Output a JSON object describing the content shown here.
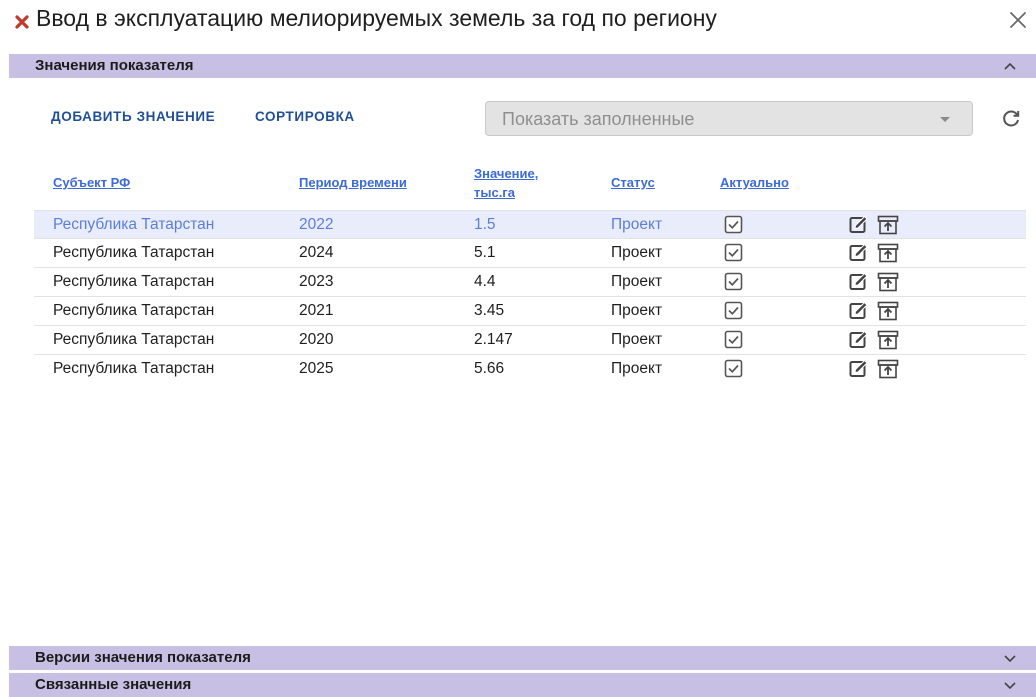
{
  "window": {
    "title": "Ввод в эксплуатацию мелиорируемых земель за год по региону",
    "title_icon": "red-cross-icon",
    "close_icon": "close-icon"
  },
  "sections": {
    "values": {
      "label": "Значения показателя",
      "expanded": true
    },
    "versions": {
      "label": "Версии значения показателя",
      "expanded": false
    },
    "related": {
      "label": "Связанные значения",
      "expanded": false
    }
  },
  "toolbar": {
    "add_label": "ДОБАВИТЬ ЗНАЧЕНИЕ",
    "sort_label": "СОРТИРОВКА",
    "filter_placeholder": "Показать заполненные",
    "refresh_icon": "refresh-icon"
  },
  "table": {
    "columns": {
      "subject": "Субъект РФ",
      "period": "Период времени",
      "value_line1": "Значение,",
      "value_line2": "тыс.га",
      "status": "Статус",
      "actual": "Актуально"
    },
    "rows": [
      {
        "subject": "Республика Татарстан",
        "period": "2022",
        "value": "1.5",
        "status": "Проект",
        "actual": true,
        "selected": true
      },
      {
        "subject": "Республика Татарстан",
        "period": "2024",
        "value": "5.1",
        "status": "Проект",
        "actual": true,
        "selected": false
      },
      {
        "subject": "Республика Татарстан",
        "period": "2023",
        "value": "4.4",
        "status": "Проект",
        "actual": true,
        "selected": false
      },
      {
        "subject": "Республика Татарстан",
        "period": "2021",
        "value": "3.45",
        "status": "Проект",
        "actual": true,
        "selected": false
      },
      {
        "subject": "Республика Татарстан",
        "period": "2020",
        "value": "2.147",
        "status": "Проект",
        "actual": true,
        "selected": false
      },
      {
        "subject": "Республика Татарстан",
        "period": "2025",
        "value": "5.66",
        "status": "Проект",
        "actual": true,
        "selected": false
      }
    ]
  },
  "colors": {
    "section_header_bg": "#c7c0e4",
    "link_blue": "#3b6bd6",
    "button_blue": "#1f4f99",
    "selected_row_bg": "#e9edfb",
    "title_icon_red": "#c0392b"
  }
}
